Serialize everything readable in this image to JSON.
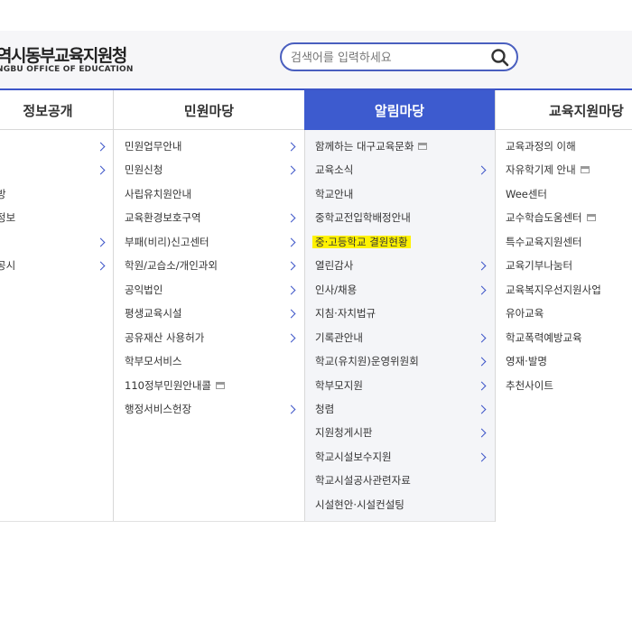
{
  "header": {
    "logo_title": "역시동부교육지원청",
    "logo_subtitle": "NGBU OFFICE OF EDUCATION",
    "search_placeholder": "검색어를 입력하세요",
    "search_icon": "search-icon"
  },
  "nav": {
    "tabs": [
      {
        "label": "정보공개"
      },
      {
        "label": "민원마당"
      },
      {
        "label": "알림마당",
        "active": true
      },
      {
        "label": "교육지원마당"
      }
    ]
  },
  "menu": {
    "col0": [
      {
        "label": "",
        "chevron": true
      },
      {
        "label": "",
        "chevron": true
      },
      {
        "label": "방"
      },
      {
        "label": "정보"
      },
      {
        "label": "",
        "chevron": true
      },
      {
        "label": "공시",
        "chevron": true
      }
    ],
    "col1": [
      {
        "label": "민원업무안내",
        "chevron": true
      },
      {
        "label": "민원신청",
        "chevron": true
      },
      {
        "label": "사립유치원안내"
      },
      {
        "label": "교육환경보호구역",
        "chevron": true
      },
      {
        "label": "부패(비리)신고센터",
        "chevron": true
      },
      {
        "label": "학원/교습소/개인과외",
        "chevron": true
      },
      {
        "label": "공익법인",
        "chevron": true
      },
      {
        "label": "평생교육시설",
        "chevron": true
      },
      {
        "label": "공유재산 사용허가",
        "chevron": true
      },
      {
        "label": "학부모서비스"
      },
      {
        "label": "110정부민원안내콜",
        "new_window": true
      },
      {
        "label": "행정서비스헌장",
        "chevron": true
      }
    ],
    "col2": [
      {
        "label": "함께하는 대구교육문화",
        "new_window": true
      },
      {
        "label": "교육소식",
        "chevron": true
      },
      {
        "label": "학교안내"
      },
      {
        "label": "중학교전입학배정안내"
      },
      {
        "label": "중·고등학교 결원현황",
        "highlighted": true
      },
      {
        "label": "열린감사",
        "chevron": true
      },
      {
        "label": "인사/채용",
        "chevron": true
      },
      {
        "label": "지침·자치법규"
      },
      {
        "label": "기록관안내",
        "chevron": true
      },
      {
        "label": "학교(유치원)운영위원회",
        "chevron": true
      },
      {
        "label": "학부모지원",
        "chevron": true
      },
      {
        "label": "청렴",
        "chevron": true
      },
      {
        "label": "지원청게시판",
        "chevron": true
      },
      {
        "label": "학교시설보수지원",
        "chevron": true
      },
      {
        "label": "학교시설공사관련자료"
      },
      {
        "label": "시설현안·시설컨설팅"
      }
    ],
    "col3": [
      {
        "label": "교육과정의 이해"
      },
      {
        "label": "자유학기제 안내",
        "new_window": true
      },
      {
        "label": "Wee센터"
      },
      {
        "label": "교수학습도움센터",
        "new_window": true
      },
      {
        "label": "특수교육지원센터"
      },
      {
        "label": "교육기부나눔터"
      },
      {
        "label": "교육복지우선지원사업"
      },
      {
        "label": "유아교육"
      },
      {
        "label": "학교폭력예방교육"
      },
      {
        "label": "영재·발명"
      },
      {
        "label": "추천사이트"
      }
    ]
  },
  "colors": {
    "accent": "#3d5bcf",
    "highlight": "#fff200"
  }
}
